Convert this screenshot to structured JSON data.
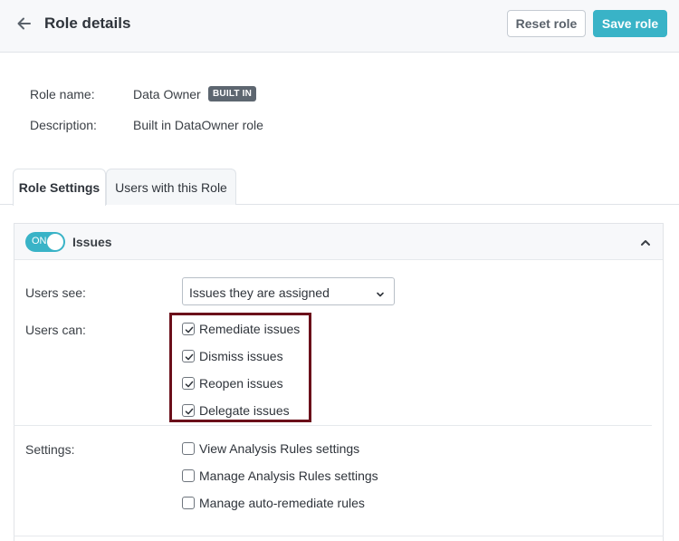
{
  "header": {
    "title": "Role details",
    "reset_label": "Reset role",
    "save_label": "Save role",
    "back_icon": "arrow-left-icon"
  },
  "info": {
    "role_name_label": "Role name:",
    "role_name_value": "Data Owner",
    "badge": "BUILT IN",
    "description_label": "Description:",
    "description_value": "Built in DataOwner role"
  },
  "tabs": [
    {
      "label": "Role Settings",
      "active": true
    },
    {
      "label": "Users with this Role",
      "active": false
    }
  ],
  "section": {
    "toggle_label": "ON",
    "title": "Issues",
    "users_see_label": "Users see:",
    "users_see_value": "Issues they are assigned",
    "users_can_label": "Users can:",
    "permissions": [
      {
        "label": "Remediate issues",
        "checked": true
      },
      {
        "label": "Dismiss issues",
        "checked": true
      },
      {
        "label": "Reopen issues",
        "checked": true
      },
      {
        "label": "Delegate issues",
        "checked": true
      }
    ],
    "settings_label": "Settings:",
    "settings": [
      {
        "label": "View Analysis Rules settings",
        "checked": false
      },
      {
        "label": "Manage Analysis Rules settings",
        "checked": false
      },
      {
        "label": "Manage auto-remediate rules",
        "checked": false
      }
    ]
  },
  "colors": {
    "accent": "#39b3c7",
    "highlight_border": "#6b0f1a",
    "badge_bg": "#5d6670"
  }
}
